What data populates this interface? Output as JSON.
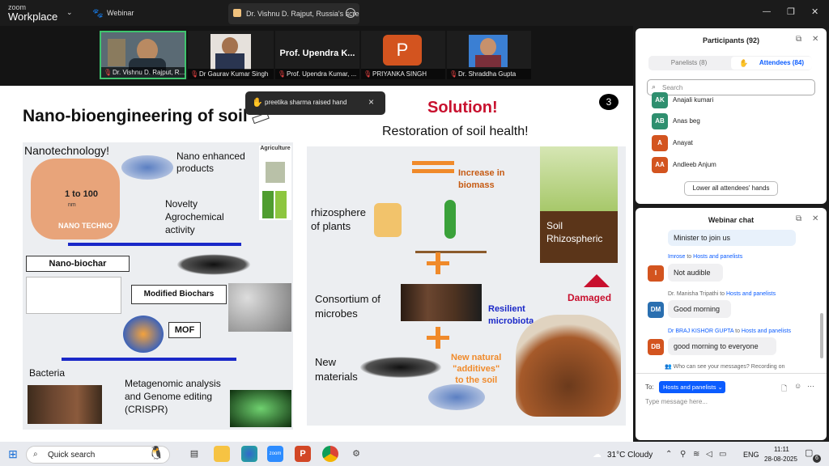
{
  "titlebar": {
    "app_top": "zoom",
    "app_bottom": "Workplace",
    "webinar_label": "Webinar",
    "tab_title": "Dr. Vishnu D. Rajput, Russia's scre",
    "minimize": "—",
    "restore": "❐",
    "close": "✕"
  },
  "videos": [
    {
      "name": "Dr. Vishnu D. Rajput, R..."
    },
    {
      "name": "Dr Gaurav Kumar Singh"
    },
    {
      "name": "Prof. Upendra Kumar, ...",
      "big_text": "Prof. Upendra K..."
    },
    {
      "name": "PRIYANKA SINGH",
      "initial": "P"
    },
    {
      "name": "Dr. Shraddha Gupta"
    }
  ],
  "notification": {
    "text": "preetika sharma raised hand",
    "close": "×"
  },
  "slide": {
    "title": "Nano-bioengineering of soil",
    "solution": "Solution!",
    "subtitle": "Restoration of soil health!",
    "page": "3",
    "left": {
      "nanotech": "Nanotechnology!",
      "agriculture": "Agriculture",
      "nano_products": "Nano enhanced\nproducts",
      "size": "1 to 100",
      "nm": "nm",
      "nanotech_hand": "NANO TECHNO",
      "novelty": "Novelty\nAgrochemical\nactivity",
      "nano_biochar": "Nano-biochar",
      "modified": "Modified Biochars",
      "mof": "MOF",
      "bacteria": "Bacteria",
      "metagenomic": "Metagenomic analysis\nand Genome editing\n(CRISPR)"
    },
    "right": {
      "increase": "Increase in\nbiomass",
      "rhizosphere": "rhizosphere\nof plants",
      "soil": "Soil\nRhizospheric",
      "consortium": "Consortium of\nmicrobes",
      "resilient": "Resilient\nmicrobiota",
      "damaged": "Damaged",
      "new_materials": "New\nmaterials",
      "additives": "New natural\n\"additives\"\nto the soil"
    }
  },
  "participants": {
    "title": "Participants (92)",
    "tab_panelists": "Panelists (8)",
    "tab_attendees": "Attendees (84)",
    "search_placeholder": "Search",
    "list": [
      {
        "initials": "AK",
        "name": "Anajali kumari",
        "color": "#2f8f6f"
      },
      {
        "initials": "AB",
        "name": "Anas beg",
        "color": "#2f8f6f"
      },
      {
        "initials": "A",
        "name": "Anayat",
        "color": "#d3541f"
      },
      {
        "initials": "AA",
        "name": "Andleeb Anjum",
        "color": "#d3541f"
      }
    ],
    "lower_hands": "Lower all attendees' hands"
  },
  "chat": {
    "title": "Webinar chat",
    "messages": [
      {
        "sender": "",
        "to": "",
        "text": "Minister to join us",
        "initials": "",
        "color": ""
      },
      {
        "sender": "Imrose",
        "to": "Hosts and panelists",
        "text": "Not audible",
        "initials": "I",
        "color": "#d3541f"
      },
      {
        "sender": "Dr. Manisha Tripathi",
        "to": "Hosts and panelists",
        "text": "Good morning",
        "initials": "DM",
        "color": "#2a6fb0"
      },
      {
        "sender": "Dr BRAJ KISHOR GUPTA",
        "to": "Hosts and panelists",
        "text": "good morning to everyone",
        "initials": "DB",
        "color": "#d3541f"
      }
    ],
    "to_word": "to",
    "visibility": "Who can see your messages? Recording on",
    "to_label": "To:",
    "recipient": "Hosts and panelists",
    "placeholder": "Type message here..."
  },
  "taskbar": {
    "search": "Quick search",
    "weather": "31°C  Cloudy",
    "lang": "ENG",
    "time": "11:11",
    "date": "28-08-2025",
    "notif_count": "6"
  }
}
